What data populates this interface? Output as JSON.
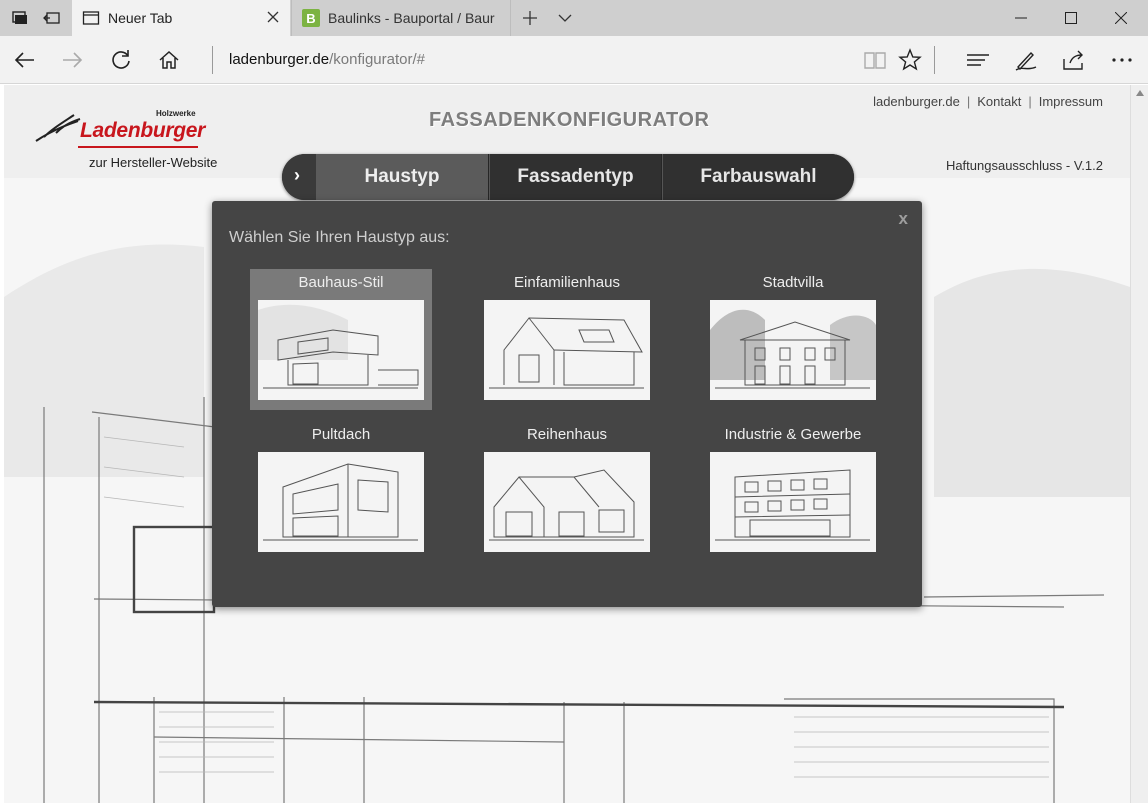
{
  "browser": {
    "tabs": [
      {
        "label": "Neuer Tab",
        "active": true
      },
      {
        "label": "Baulinks - Bauportal / Baur",
        "active": false,
        "favicon_letter": "B"
      }
    ],
    "url": {
      "host": "ladenburger.de",
      "path": "/konfigurator/#"
    }
  },
  "site": {
    "logo": {
      "small_text": "Holzwerke",
      "name": "Ladenburger"
    },
    "maker_link": "zur Hersteller-Website",
    "title": "FASSADENKONFIGURATOR",
    "links": [
      "ladenburger.de",
      "Kontakt",
      "Impressum"
    ],
    "link_separator": "|",
    "version": "Haftungsausschluss - V.1.2",
    "steps": {
      "arrow": "›",
      "items": [
        "Haustyp",
        "Fassadentyp",
        "Farbauswahl"
      ],
      "active_index": 0
    }
  },
  "modal": {
    "close": "x",
    "title": "Wählen Sie Ihren Haustyp aus:",
    "options": [
      {
        "label": "Bauhaus-Stil",
        "selected": true
      },
      {
        "label": "Einfamilienhaus",
        "selected": false
      },
      {
        "label": "Stadtvilla",
        "selected": false
      },
      {
        "label": "Pultdach",
        "selected": false
      },
      {
        "label": "Reihenhaus",
        "selected": false
      },
      {
        "label": "Industrie & Gewerbe",
        "selected": false
      }
    ]
  },
  "colors": {
    "accent": "#c8161d",
    "modal_bg": "#454545",
    "nav_bg": "#262626",
    "nav_active": "#5b5b5b"
  }
}
